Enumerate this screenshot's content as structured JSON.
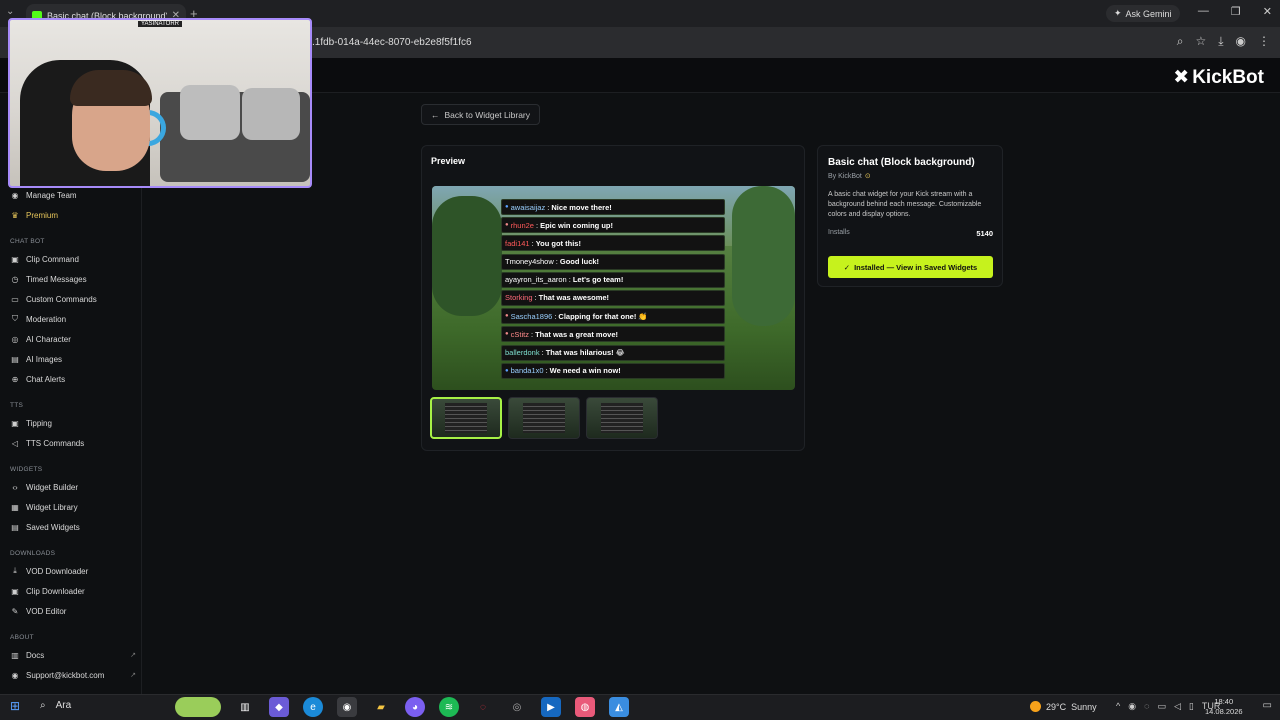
{
  "browser": {
    "tab_title": "Basic chat (Block background)",
    "url": ".1fdb-014a-44ec-8070-eb2e8f5f1fc6",
    "ask_gemini": "Ask Gemini",
    "new_tab": "+"
  },
  "app": {
    "logo": "KickBot"
  },
  "webcam": {
    "tag": "YASINATORR"
  },
  "sidebar": {
    "items_top": [
      {
        "label": "Manage Team",
        "icon": "users-icon"
      },
      {
        "label": "Premium",
        "icon": "crown-icon"
      }
    ],
    "sections": [
      {
        "heading": "CHAT BOT",
        "items": [
          {
            "label": "Clip Command"
          },
          {
            "label": "Timed Messages"
          },
          {
            "label": "Custom Commands"
          },
          {
            "label": "Moderation"
          },
          {
            "label": "AI Character"
          },
          {
            "label": "AI Images"
          },
          {
            "label": "Chat Alerts"
          }
        ]
      },
      {
        "heading": "TTS",
        "items": [
          {
            "label": "Tipping"
          },
          {
            "label": "TTS Commands"
          }
        ]
      },
      {
        "heading": "WIDGETS",
        "items": [
          {
            "label": "Widget Builder"
          },
          {
            "label": "Widget Library"
          },
          {
            "label": "Saved Widgets"
          }
        ]
      },
      {
        "heading": "DOWNLOADS",
        "items": [
          {
            "label": "VOD Downloader"
          },
          {
            "label": "Clip Downloader"
          },
          {
            "label": "VOD Editor"
          }
        ]
      },
      {
        "heading": "ABOUT",
        "items": [
          {
            "label": "Docs"
          },
          {
            "label": "Support@kickbot.com"
          }
        ]
      }
    ]
  },
  "main": {
    "back_label": "Back to Widget Library",
    "preview_title": "Preview",
    "chat_messages": [
      {
        "user": "awaisaijaz",
        "text": "Nice move there!",
        "color": "#9ad0ff"
      },
      {
        "user": "rhun2e",
        "text": "Epic win coming up!",
        "color": "#ff5a5a"
      },
      {
        "user": "fadi141",
        "text": "You got this!",
        "color": "#ff5a5a"
      },
      {
        "user": "Tmoney4show",
        "text": "Good luck!",
        "color": "#ffffff"
      },
      {
        "user": "ayayron_its_aaron",
        "text": "Let's go team!",
        "color": "#ffffff"
      },
      {
        "user": "Storking",
        "text": "That was awesome!",
        "color": "#ff6a7a"
      },
      {
        "user": "Sascha1896",
        "text": "Clapping for that one! 👏",
        "color": "#9ad0ff"
      },
      {
        "user": "cStitz",
        "text": "That was a great move!",
        "color": "#ff8a8a"
      },
      {
        "user": "ballerdonk",
        "text": "That was hilarious! 😂",
        "color": "#7fe0d0"
      },
      {
        "user": "banda1x0",
        "text": "We need a win now!",
        "color": "#9ad0ff"
      }
    ]
  },
  "info": {
    "title": "Basic chat (Block background)",
    "by": "By KickBot",
    "description": "A basic chat widget for your Kick stream with a background behind each message. Customizable colors and display options.",
    "installs_label": "Installs",
    "installs_value": "5140",
    "install_button": "Installed — View in Saved Widgets"
  },
  "taskbar": {
    "search_label": "Ara",
    "weather_temp": "29°C",
    "weather_text": "Sunny",
    "lang": "TUR",
    "time": "18:40",
    "date": "14.08.2026"
  },
  "colors": {
    "accent": "#c6f21d",
    "premium": "#e7c65a"
  }
}
